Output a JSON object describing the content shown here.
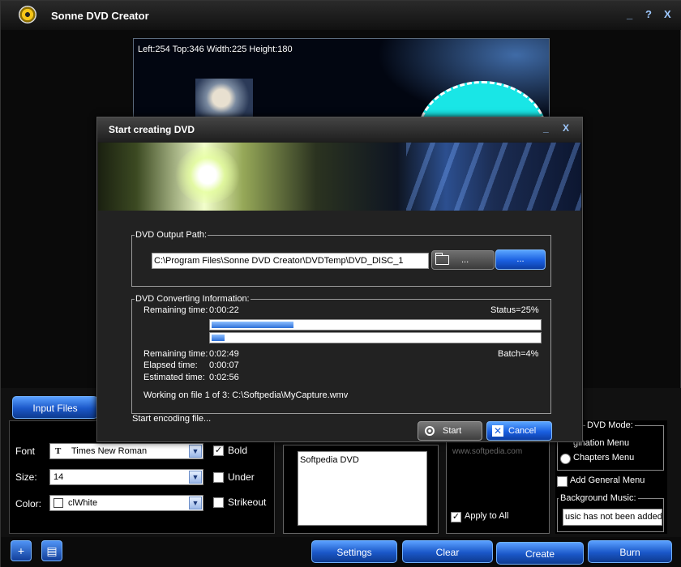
{
  "app": {
    "title": "Sonne DVD Creator",
    "titlebar_buttons": [
      "_",
      "?",
      "X"
    ]
  },
  "preview": {
    "coords_text": "Left:254   Top:346   Width:225   Height:180"
  },
  "left_panel": {
    "input_files_label": "Input Files",
    "font_label": "Font",
    "font_value": "Times New Roman",
    "bold_label": "Bold",
    "bold_checked": true,
    "size_label": "Size:",
    "size_value": "14",
    "under_label": "Under",
    "color_label": "Color:",
    "color_value": "clWhite",
    "strikeout_label": "Strikeout"
  },
  "text_list": {
    "items": [
      "Softpedia DVD"
    ]
  },
  "mid_panel": {
    "apply_to_all_label": "Apply to All",
    "apply_to_all_checked": true
  },
  "right_panel": {
    "dvd_mode_title": "DVD Mode:",
    "pagination_menu_label": "gination Menu",
    "chapters_menu_label": "Chapters Menu",
    "add_general_menu_label": "Add General Menu",
    "background_music_title": "Background Music:",
    "background_music_value": "usic has not been added"
  },
  "bottom_buttons": {
    "settings": "Settings",
    "clear": "Clear",
    "create": "Create",
    "burn": "Burn"
  },
  "dialog": {
    "title": "Start creating DVD",
    "titlebar_buttons": [
      "_",
      "X"
    ],
    "output_group_title": "DVD Output Path:",
    "output_path": "C:\\Program Files\\Sonne DVD Creator\\DVDTemp\\DVD_DISC_1",
    "browse_folder_label": "...",
    "browse_dots_label": "...",
    "converting_group_title": "DVD Converting Information:",
    "remaining_time_1_label": "Remaining time:",
    "remaining_time_1_value": "0:00:22",
    "status_text": "Status=25%",
    "status_progress": 0.25,
    "batch_progress": 0.04,
    "remaining_time_2_label": "Remaining time:",
    "remaining_time_2_value": "0:02:49",
    "batch_text": "Batch=4%",
    "elapsed_time_label": "Elapsed time:",
    "elapsed_time_value": "0:00:07",
    "estimated_time_label": "Estimated time:",
    "estimated_time_value": "0:02:56",
    "working_on": "Working on file 1 of 3: C:\\Softpedia\\MyCapture.wmv",
    "status_line": "Start encoding file...",
    "start_label": "Start",
    "cancel_label": "Cancel"
  },
  "watermark": "www.softpedia.com",
  "colors": {
    "accent_blue": "#1a5fe0",
    "disc_cyan": "#19e6e6"
  }
}
